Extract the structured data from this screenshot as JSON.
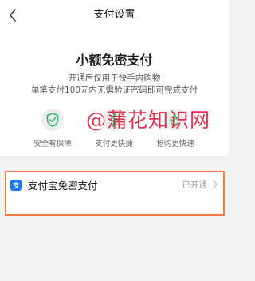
{
  "header": {
    "title": "支付设置",
    "back_icon": "chevron-left-icon"
  },
  "intro": {
    "headline": "小额免密支付",
    "description_line1": "开通后仅用于快手内购物",
    "description_line2": "单笔支付100元内无需验证密码即可完成支付"
  },
  "features": [
    {
      "icon": "shield-check-icon",
      "label": "安全有保障"
    },
    {
      "icon": "lightning-icon",
      "label": "支付更快捷"
    },
    {
      "icon": "hand-icon",
      "label": "抢购更快速"
    }
  ],
  "watermark": "@蒲花知识网",
  "option": {
    "icon": "alipay-icon",
    "label": "支付宝免密支付",
    "status": "已开通",
    "chevron_icon": "chevron-right-icon"
  },
  "colors": {
    "accent_green": "#2eb872",
    "highlight_border": "#ef7b3e",
    "alipay_blue": "#1677ff",
    "watermark_red": "#e2233f"
  }
}
